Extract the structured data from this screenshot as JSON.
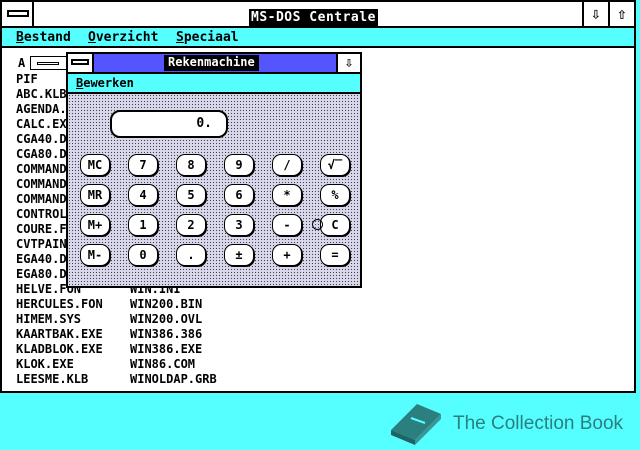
{
  "main_window": {
    "title": "MS-DOS Centrale",
    "minimize_glyph": "⇩",
    "maximize_glyph": "⇧",
    "menu": [
      "Bestand",
      "Overzicht",
      "Speciaal"
    ]
  },
  "drive": {
    "letter": "A"
  },
  "files": [
    [
      "PIF",
      ""
    ],
    [
      "ABC.KLB",
      ""
    ],
    [
      "AGENDA.EXE",
      ""
    ],
    [
      "CALC.EXE",
      ""
    ],
    [
      "CGA40.DRV",
      ""
    ],
    [
      "CGA80.DRV",
      ""
    ],
    [
      "COMMAND.COM",
      ""
    ],
    [
      "COMMAND.PIF",
      ""
    ],
    [
      "COMMAND.EXE",
      ""
    ],
    [
      "CONTROL.EXE",
      ""
    ],
    [
      "COURE.FON",
      ""
    ],
    [
      "CVTPAINT.EXE",
      ""
    ],
    [
      "EGA40.DRV",
      ""
    ],
    [
      "EGA80.DRV",
      ""
    ],
    [
      "HELVE.FON",
      "WIN.INI"
    ],
    [
      "HERCULES.FON",
      "WIN200.BIN"
    ],
    [
      "HIMEM.SYS",
      "WIN200.OVL"
    ],
    [
      "KAARTBAK.EXE",
      "WIN386.386"
    ],
    [
      "KLADBLOK.EXE",
      "WIN386.EXE"
    ],
    [
      "KLOK.EXE",
      "WIN86.COM"
    ],
    [
      "LEESME.KLB",
      "WINOLDAP.GRB"
    ]
  ],
  "calculator": {
    "title": "Rekenmachine",
    "minimize_glyph": "⇩",
    "menu": [
      "Bewerken"
    ],
    "display": "0.",
    "buttons": [
      [
        "MC",
        "7",
        "8",
        "9",
        "/",
        "√‾"
      ],
      [
        "MR",
        "4",
        "5",
        "6",
        "*",
        "%"
      ],
      [
        "M+",
        "1",
        "2",
        "3",
        "-",
        "C"
      ],
      [
        "M-",
        "0",
        ".",
        "±",
        "+",
        "="
      ]
    ]
  },
  "watermark": {
    "text": "The Collection Book",
    "color": "#2b7f7f"
  },
  "colors": {
    "desktop": "#55ffff",
    "menubar": "#55ffff",
    "calc_titlebar": "#5555ff"
  }
}
